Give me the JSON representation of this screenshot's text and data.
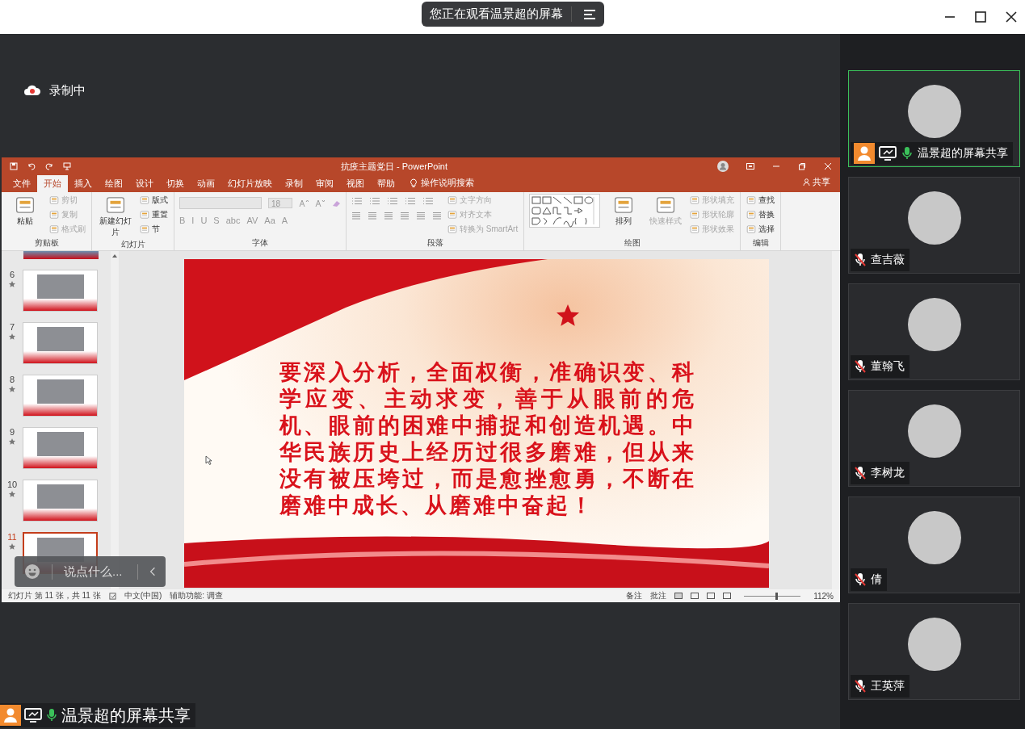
{
  "top_banner": {
    "text": "您正在观看温景超的屏幕"
  },
  "recording": {
    "label": "录制中"
  },
  "powerpoint": {
    "title": "抗疫主题党日  -  PowerPoint",
    "share": "共享",
    "tabs": [
      {
        "label": "文件",
        "selected": false
      },
      {
        "label": "开始",
        "selected": true
      },
      {
        "label": "插入",
        "selected": false
      },
      {
        "label": "绘图",
        "selected": false
      },
      {
        "label": "设计",
        "selected": false
      },
      {
        "label": "切换",
        "selected": false
      },
      {
        "label": "动画",
        "selected": false
      },
      {
        "label": "幻灯片放映",
        "selected": false
      },
      {
        "label": "录制",
        "selected": false
      },
      {
        "label": "审阅",
        "selected": false
      },
      {
        "label": "视图",
        "selected": false
      },
      {
        "label": "帮助",
        "selected": false
      }
    ],
    "search": {
      "placeholder": "操作说明搜索"
    },
    "ribbon_groups": [
      {
        "kind": "clipboard",
        "label": "剪贴板",
        "large": [
          {
            "text": "粘贴",
            "disabled": false
          }
        ],
        "small": [
          {
            "text": "剪切",
            "disabled": true
          },
          {
            "text": "复制",
            "disabled": true
          },
          {
            "text": "格式刷",
            "disabled": true
          }
        ]
      },
      {
        "kind": "slides",
        "label": "幻灯片",
        "large": [
          {
            "text": "新建幻灯片",
            "disabled": false
          }
        ],
        "small": [
          {
            "text": "版式",
            "disabled": false
          },
          {
            "text": "重置",
            "disabled": false
          },
          {
            "text": "节",
            "disabled": false
          }
        ]
      },
      {
        "kind": "font",
        "label": "字体",
        "font_size": "18",
        "glyphs": [
          "B",
          "I",
          "U",
          "S",
          "abc",
          "AV",
          "Aa",
          "A"
        ]
      },
      {
        "kind": "paragraph",
        "label": "段落",
        "small": [
          {
            "text": "文字方向",
            "disabled": true
          },
          {
            "text": "对齐文本",
            "disabled": true
          },
          {
            "text": "转换为 SmartArt",
            "disabled": true
          }
        ]
      },
      {
        "kind": "drawing",
        "label": "绘图",
        "large": [
          {
            "text": "排列",
            "disabled": false
          },
          {
            "text": "快速样式",
            "disabled": true
          }
        ],
        "small": [
          {
            "text": "形状填充",
            "disabled": true
          },
          {
            "text": "形状轮廓",
            "disabled": true
          },
          {
            "text": "形状效果",
            "disabled": true
          }
        ]
      },
      {
        "kind": "editing",
        "label": "编辑",
        "small": [
          {
            "text": "查找",
            "disabled": false
          },
          {
            "text": "替换",
            "disabled": false
          },
          {
            "text": "选择",
            "disabled": false
          }
        ]
      }
    ],
    "slides": [
      {
        "number": "6",
        "selected": false
      },
      {
        "number": "7",
        "selected": false
      },
      {
        "number": "8",
        "selected": false
      },
      {
        "number": "9",
        "selected": false
      },
      {
        "number": "10",
        "selected": false
      },
      {
        "number": "11",
        "selected": true
      }
    ],
    "slide_text": "要深入分析，全面权衡，准确识变、科学应变、主动求变，善于从眼前的危机、眼前的困难中捕捉和创造机遇。中华民族历史上经历过很多磨难，但从来没有被压垮过，而是愈挫愈勇，不断在磨难中成长、从磨难中奋起！",
    "status_bar": {
      "slide_info": "幻灯片 第 11 张，共 11 张",
      "language": "中文(中国)",
      "accessibility": "辅助功能: 调查",
      "notes": "备注",
      "comments": "批注",
      "zoom": {
        "level": 0.55,
        "reading": "112%"
      }
    }
  },
  "chat": {
    "placeholder": "说点什么..."
  },
  "participants": [
    {
      "name": "温景超的屏幕共享",
      "selected": true,
      "muted": false,
      "sharing": true
    },
    {
      "name": "查吉薇",
      "selected": false,
      "muted": true,
      "sharing": false
    },
    {
      "name": "董翰飞",
      "selected": false,
      "muted": true,
      "sharing": false
    },
    {
      "name": "李树龙",
      "selected": false,
      "muted": true,
      "sharing": false
    },
    {
      "name": "倩",
      "selected": false,
      "muted": true,
      "sharing": false
    },
    {
      "name": "王英萍",
      "selected": false,
      "muted": true,
      "sharing": false
    }
  ],
  "share_label": {
    "text": "温景超的屏幕共享"
  }
}
